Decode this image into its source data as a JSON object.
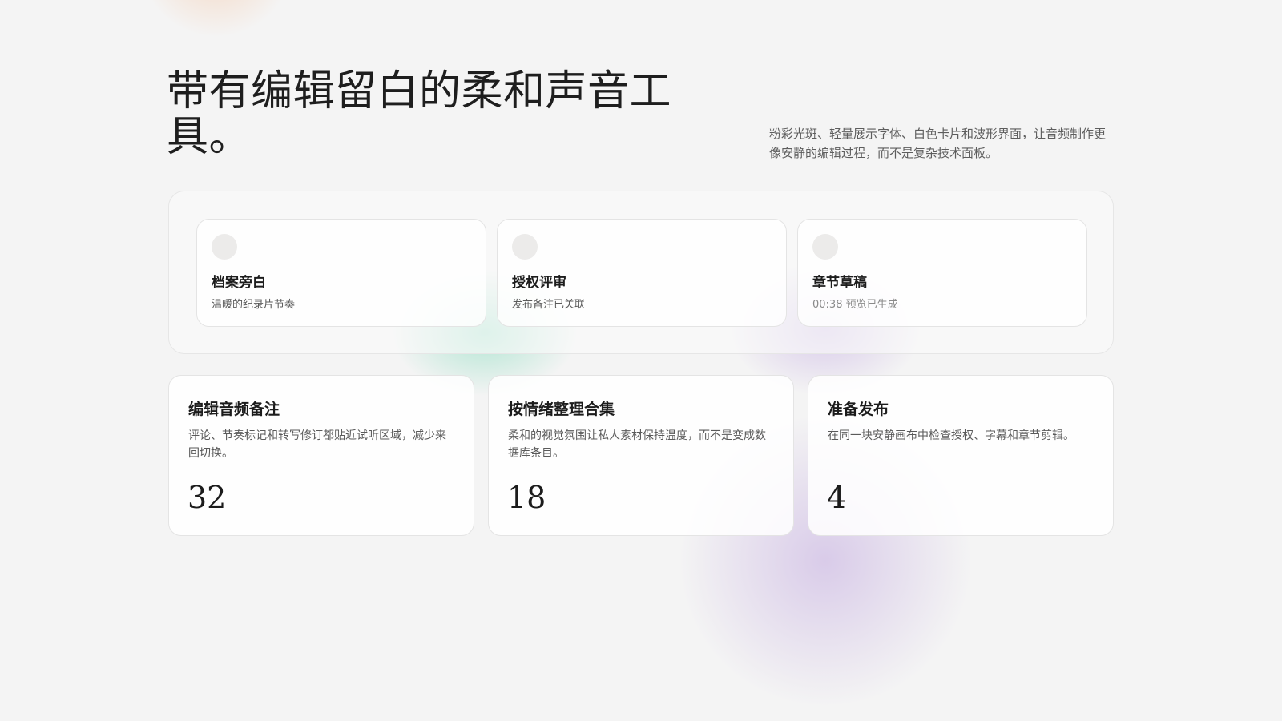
{
  "hero": {
    "headline": "带有编辑留白的柔和声音工具。",
    "intro": "粉彩光斑、轻量展示字体、白色卡片和波形界面，让音频制作更像安静的编辑过程，而不是复杂技术面板。"
  },
  "tracks": [
    {
      "title": "档案旁白",
      "meta": "温暖的纪录片节奏"
    },
    {
      "title": "授权评审",
      "meta": "发布备注已关联"
    },
    {
      "title": "章节草稿",
      "meta": "00:38 预览已生成"
    }
  ],
  "features": [
    {
      "title": "编辑音频备注",
      "description": "评论、节奏标记和转写修订都贴近试听区域，减少来回切换。",
      "count": "32"
    },
    {
      "title": "按情绪整理合集",
      "description": "柔和的视觉氛围让私人素材保持温度，而不是变成数据库条目。",
      "count": "18"
    },
    {
      "title": "准备发布",
      "description": "在同一块安静画布中检查授权、字幕和章节剪辑。",
      "count": "4"
    }
  ],
  "colors": {
    "background": "#f4f4f4",
    "card": "#ffffff",
    "blob_peach": "#f6be96",
    "blob_mint": "#7ad8b6",
    "blob_lavender": "#c8b2e2"
  }
}
